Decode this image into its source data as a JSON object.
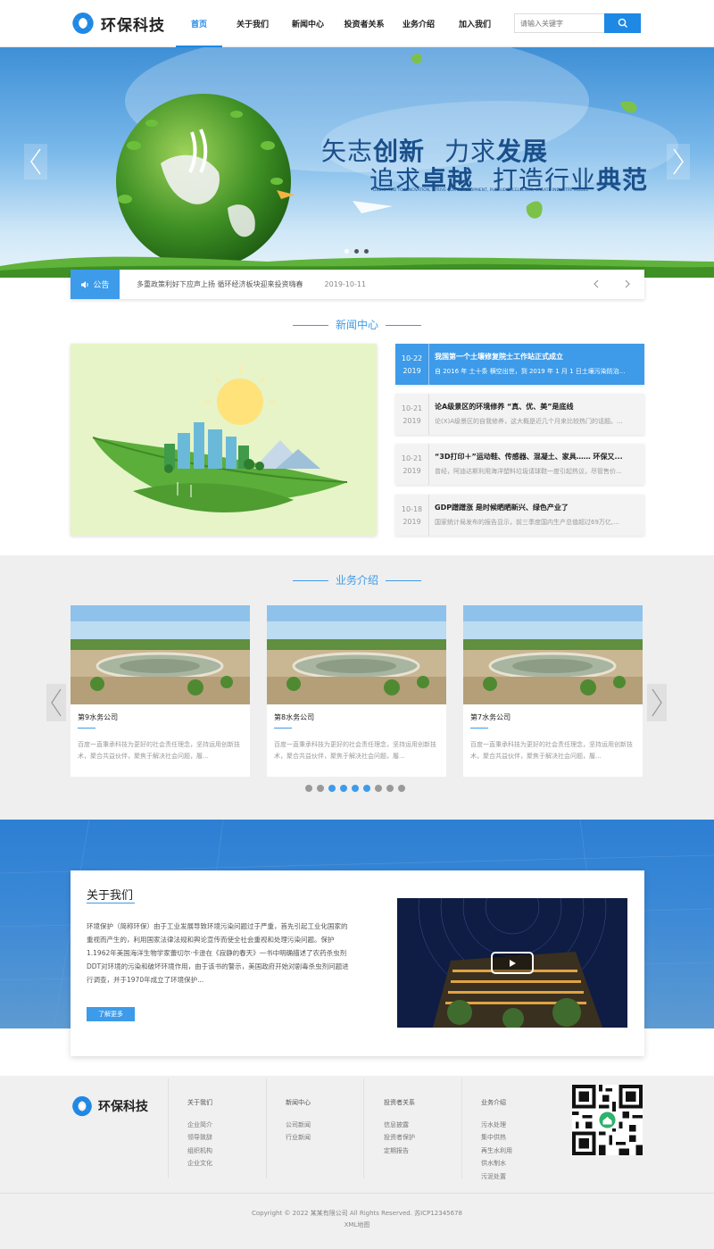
{
  "header": {
    "logo_text": "环保科技",
    "nav": [
      "首页",
      "关于我们",
      "新闻中心",
      "投资者关系",
      "业务介绍",
      "加入我们"
    ],
    "search_placeholder": "请输入关键字"
  },
  "banner": {
    "line1_a": "矢志",
    "line1_b": "创新",
    "line1_c": "力求",
    "line1_d": "发展",
    "line2_a": "追求",
    "line2_b": "卓越",
    "line2_c": "打造行业",
    "line2_d": "典范",
    "subtitle": "DEDICATED TO INNOVATION, STRIVE FOR DEVELOPMENT, PURSUE EXCELLENCE, CREATE INDUSTRY MODEL"
  },
  "notice": {
    "label": "公告",
    "text": "多重政策利好下应声上扬 循环经济板块迎来投资嗨春",
    "date": "2019-10-11"
  },
  "news": {
    "title": "新闻中心",
    "items": [
      {
        "day": "10-22",
        "year": "2019",
        "title": "我国第一个土壤修复院士工作站正式成立",
        "desc": "自 2016 年 土十条 横空出世，到 2019 年 1 月 1 日土壤污染防治..."
      },
      {
        "day": "10-21",
        "year": "2019",
        "title": "论A级景区的环境修养 “真、优、美”是底线",
        "desc": "论(X)A级景区的自我修养，这大概是近几个月来比较热门的话题。..."
      },
      {
        "day": "10-21",
        "year": "2019",
        "title": "“3D打印＋”运动鞋、传感器、混凝土、家具…… 环保又...",
        "desc": "曾经，阿迪达斯利用海洋塑料垃圾请球鞋一度引起热议，尽管售价..."
      },
      {
        "day": "10-18",
        "year": "2019",
        "title": "GDP蹭蹭涨 是时候晒晒新兴、绿色产业了",
        "desc": "国家统计局发布的报告显示，前三季度国内生产总值超过69万亿,..."
      }
    ]
  },
  "business": {
    "title": "业务介绍",
    "cards": [
      {
        "title": "第9水务公司",
        "desc": "百度一直秉承科技为更好的社会责任理念，坚持运用创新技术，聚合共益伙伴，聚焦于解决社会问题，履..."
      },
      {
        "title": "第8水务公司",
        "desc": "百度一直秉承科技为更好的社会责任理念，坚持运用创新技术，聚合共益伙伴，聚焦于解决社会问题，履..."
      },
      {
        "title": "第7水务公司",
        "desc": "百度一直秉承科技为更好的社会责任理念，坚持运用创新技术，聚合共益伙伴，聚焦于解决社会问题，履..."
      }
    ],
    "dots_total": 9,
    "dots_active": [
      2,
      3,
      4,
      5
    ]
  },
  "about": {
    "title": "关于我们",
    "text": "环境保护（简称环保）由于工业发展导致环境污染问题过于严重，首先引起工业化国家的重视而产生的，利用国家法律法规和舆论宣传而使全社会重视和处理污染问题。保护1.1962年美国海洋生物学家蕾切尔·卡逊在《寂静的春天》一书中明确描述了农药杀虫剂DDT对环境的污染和破坏环境作用，由于该书的警示，美国政府开始对剧毒杀虫剂问题进行调查，并于1970年成立了环境保护...",
    "more": "了解更多"
  },
  "footer": {
    "logo_text": "环保科技",
    "columns": [
      {
        "head": "关于我们",
        "items": [
          "企业简介",
          "领导致辞",
          "组织机构",
          "企业文化"
        ]
      },
      {
        "head": "新闻中心",
        "items": [
          "公司新闻",
          "行业新闻"
        ]
      },
      {
        "head": "投资者关系",
        "items": [
          "信息披露",
          "投资者保护",
          "定期报告"
        ]
      },
      {
        "head": "业务介绍",
        "items": [
          "污水处理",
          "集中供热",
          "再生水利用",
          "供水制水",
          "污泥处置"
        ]
      }
    ],
    "copyright": "Copyright © 2022 某某有限公司 All Rights Reserved. 苏ICP12345678",
    "sitemap": "XML地图"
  },
  "colors": {
    "accent": "#3d9be9",
    "brand": "#1e88e5",
    "green": "#5aa833"
  }
}
